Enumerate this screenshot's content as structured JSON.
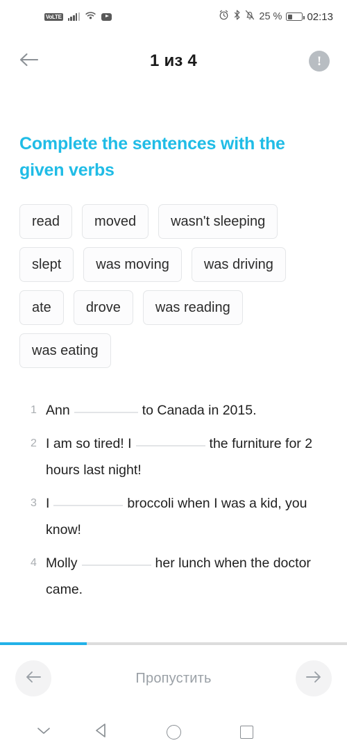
{
  "status_bar": {
    "volte_label": "VoLTE",
    "signal_icon": "signal-bars-icon",
    "wifi_icon": "wifi-icon",
    "youtube_icon": "youtube-icon",
    "alarm_icon": "alarm-clock-icon",
    "bluetooth_icon": "bluetooth-icon",
    "silent_icon": "bell-muted-icon",
    "battery_percent": "25 %",
    "battery_icon": "battery-icon",
    "time": "02:13"
  },
  "header": {
    "back_icon": "back-arrow-icon",
    "title": "1 из 4",
    "info_icon": "info-exclamation-icon",
    "info_glyph": "!"
  },
  "task": {
    "heading": "Complete the sentences with the given verbs",
    "heading_color": "#20bce6",
    "word_chips": [
      "read",
      "moved",
      "wasn't sleeping",
      "slept",
      "was moving",
      "was driving",
      "ate",
      "drove",
      "was reading",
      "was eating"
    ],
    "sentences": [
      {
        "number": "1",
        "before": "Ann",
        "after": "to Canada in 2015."
      },
      {
        "number": "2",
        "before": "I am so tired! I",
        "after": "the furniture for 2 hours last night!"
      },
      {
        "number": "3",
        "before": "I",
        "after": "broccoli when I was a kid, you know!"
      },
      {
        "number": "4",
        "before": "Molly",
        "after": "her lunch when the doctor came."
      }
    ]
  },
  "progress": {
    "percent": 25,
    "fill_color": "#22b1e8",
    "track_color": "#dcdcdc"
  },
  "footer": {
    "prev_icon": "arrow-left-icon",
    "skip_label": "Пропустить",
    "next_icon": "arrow-right-icon"
  },
  "android_nav": {
    "hide_keyboard_icon": "chevron-down-icon",
    "back_icon": "nav-back-triangle-icon",
    "home_icon": "nav-home-circle-icon",
    "recents_icon": "nav-recents-square-icon"
  }
}
